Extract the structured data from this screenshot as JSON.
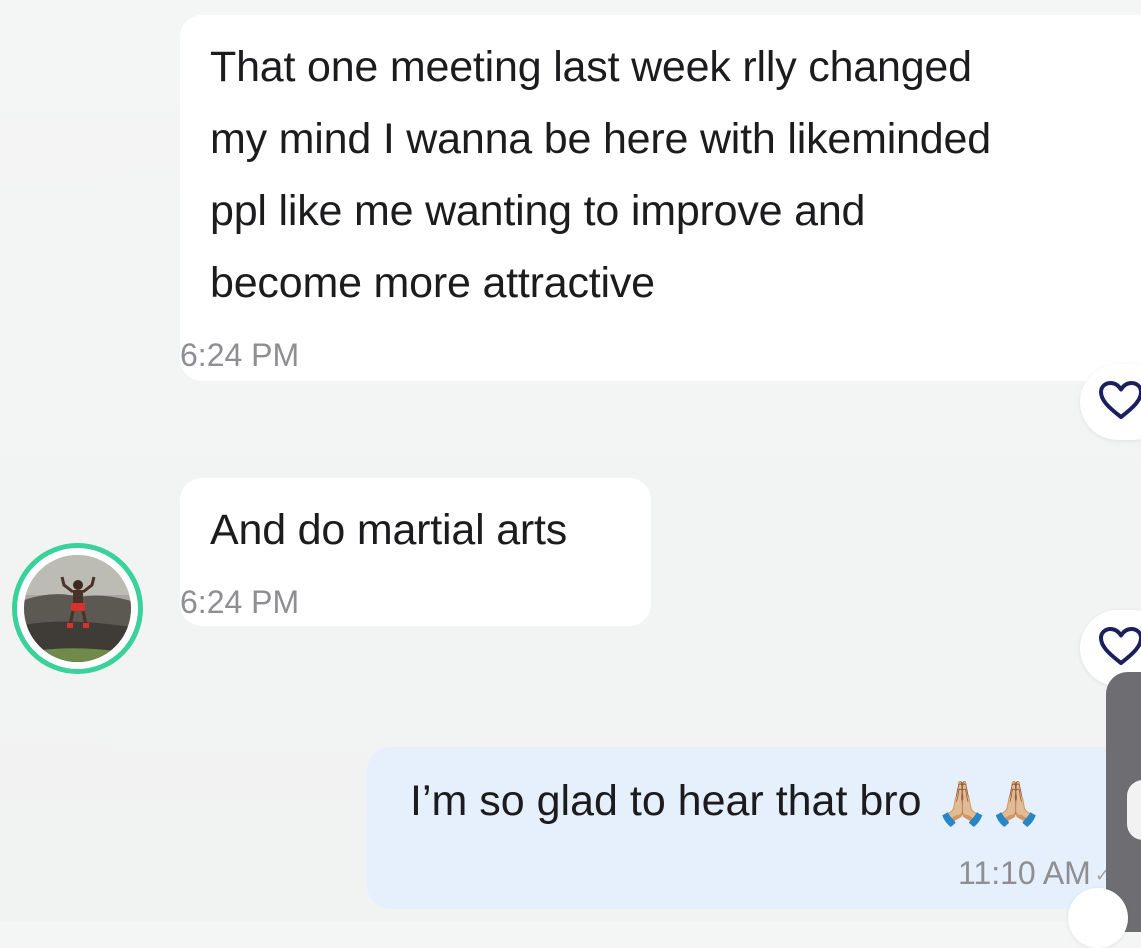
{
  "messages": [
    {
      "text": "That one meeting last week rlly changed\nmy mind I wanna be here with likeminded\nppl like me wanting to improve and\nbecome more attractive",
      "time": "6:24 PM"
    },
    {
      "text": "And do martial arts",
      "time": "6:24 PM"
    }
  ],
  "outgoing": {
    "text": "I’m so glad to hear that bro",
    "emoji": "🙏🏼🙏🏼",
    "time": "11:10 AM"
  },
  "icons": {
    "like": "heart-outline-icon",
    "avatar": "profile-photo-person-on-rocks"
  },
  "colors": {
    "avatar_ring": "#3ad19a",
    "outgoing_bubble": "#e6f0fc",
    "heart_stroke": "#1b1f5e"
  }
}
